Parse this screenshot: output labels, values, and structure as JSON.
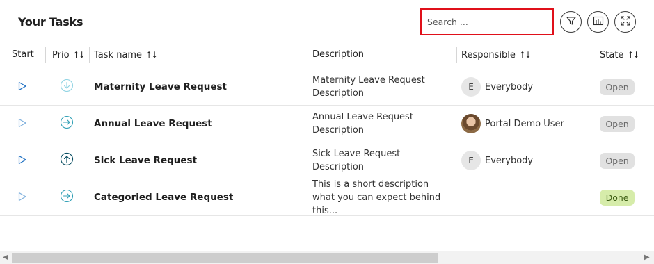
{
  "header": {
    "title": "Your Tasks",
    "search_placeholder": "Search ...",
    "filter_icon": "filter-icon",
    "columns_icon": "columns-icon",
    "expand_icon": "expand-icon"
  },
  "columns": {
    "start": "Start",
    "prio": "Prio",
    "task_name": "Task name",
    "description": "Description",
    "responsible": "Responsible",
    "state": "State",
    "sort_glyph": "↑↓"
  },
  "rows": [
    {
      "start_icon": "play-icon",
      "prio_icon": "arrow-down-circle-icon",
      "task_name": "Maternity Leave Request",
      "description": "Maternity Leave Request Description",
      "responsible": {
        "initial": "E",
        "name": "Everybody",
        "avatar": "initial"
      },
      "state": "Open"
    },
    {
      "start_icon": "play-icon",
      "prio_icon": "arrow-right-circle-icon",
      "task_name": "Annual Leave Request",
      "description": "Annual Leave Request Description",
      "responsible": {
        "initial": "",
        "name": "Portal Demo User",
        "avatar": "photo"
      },
      "state": "Open"
    },
    {
      "start_icon": "play-icon",
      "prio_icon": "arrow-up-circle-icon",
      "task_name": "Sick Leave Request",
      "description": "Sick Leave Request Description",
      "responsible": {
        "initial": "E",
        "name": "Everybody",
        "avatar": "initial"
      },
      "state": "Open"
    },
    {
      "start_icon": "play-icon",
      "prio_icon": "arrow-right-circle-icon",
      "task_name": "Categoried Leave Request",
      "description": "This is a short description what you can expect behind this...",
      "responsible": {
        "initial": "",
        "name": "",
        "avatar": "none"
      },
      "state": "Done"
    }
  ],
  "colors": {
    "search_border": "#e0101a",
    "play_icon": "#1b6ec2",
    "prio_icon": "#2f9fb5",
    "open_badge_bg": "#e1e1e1",
    "open_badge_text": "#6b6b6b",
    "done_badge_bg": "#d6ecaa",
    "done_badge_text": "#3d5e14"
  }
}
